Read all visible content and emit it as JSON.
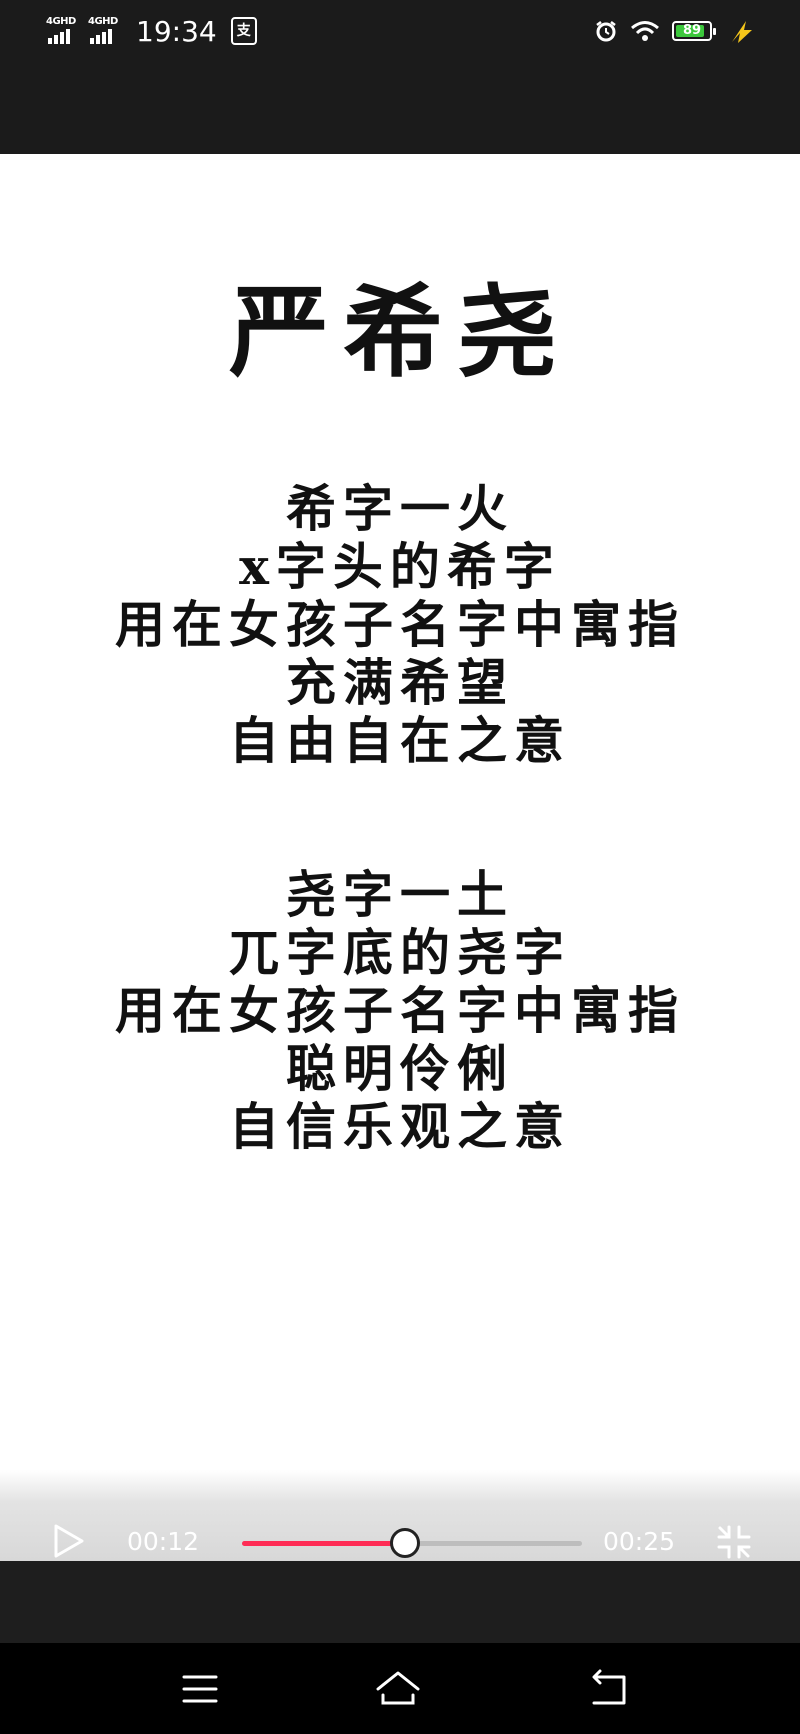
{
  "status_bar": {
    "network_1": "4GHD",
    "network_2": "4GHD",
    "time": "19:34",
    "notification_icon": "支",
    "battery_level": 89,
    "battery_text": "89"
  },
  "video": {
    "title": "严希尧",
    "stanza_1": [
      "希字一火",
      "x字头的希字",
      "用在女孩子名字中寓指",
      "充满希望",
      "自由自在之意"
    ],
    "stanza_2": [
      "尧字一土",
      "兀字底的尧字",
      "用在女孩子名字中寓指",
      "聪明伶俐",
      "自信乐观之意"
    ]
  },
  "player": {
    "current_time": "00:12",
    "total_time": "00:25",
    "progress": 0.48,
    "accent_color": "#fe2c55"
  },
  "icons": {
    "play": "play-icon",
    "fullscreen": "exit-fullscreen-icon",
    "menu": "menu-icon",
    "home": "home-icon",
    "back": "back-icon"
  }
}
